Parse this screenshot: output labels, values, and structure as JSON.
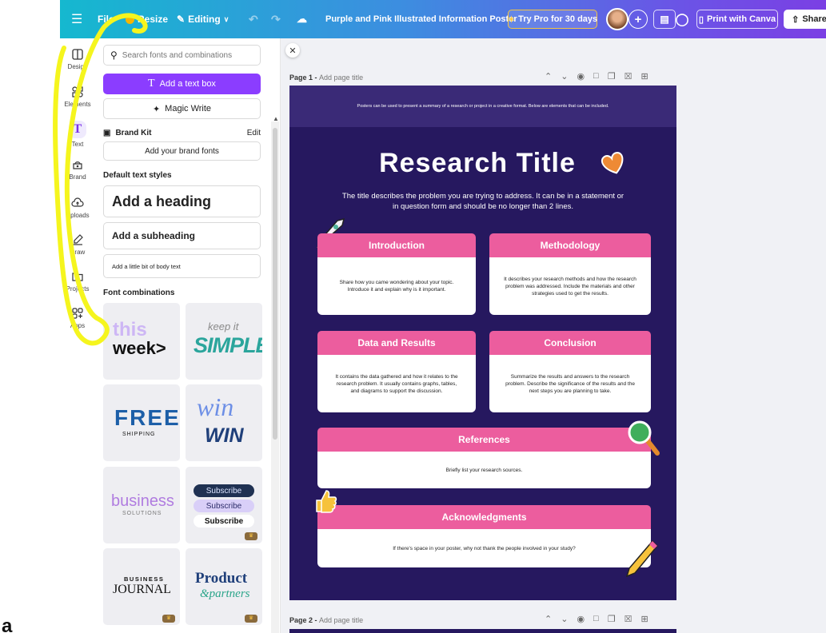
{
  "topbar": {
    "file": "File",
    "resize": "Resize",
    "editing": "Editing",
    "doc_title": "Purple and Pink Illustrated Information Poster",
    "try_pro": "Try Pro for 30 days",
    "print": "Print with Canva",
    "share": "Share"
  },
  "rail": {
    "design": "Design",
    "elements": "Elements",
    "text": "Text",
    "brand": "Brand",
    "uploads": "Uploads",
    "draw": "Draw",
    "projects": "Projects",
    "apps": "Apps"
  },
  "panel": {
    "search_placeholder": "Search fonts and combinations",
    "add_text_box": "Add a text box",
    "magic_write": "Magic Write",
    "brand_kit": "Brand Kit",
    "edit": "Edit",
    "add_brand_fonts": "Add your brand fonts",
    "default_styles": "Default text styles",
    "heading": "Add a heading",
    "subheading": "Add a subheading",
    "body": "Add a little bit of body text",
    "font_combos": "Font combinations",
    "tiles": {
      "this": "this",
      "week": "week>",
      "keepit": "keep it",
      "simple": "SIMPLE",
      "free": "FREE",
      "shipping": "SHIPPING",
      "win1": "win",
      "win2": "WIN",
      "business": "business",
      "solutions": "SOLUTIONS",
      "subscribe": "Subscribe",
      "bj1": "BUSINESS",
      "bj2": "JOURNAL",
      "prod1": "Product",
      "prod2": "&partners"
    }
  },
  "canvas": {
    "page1_label": "Page 1 -",
    "page1_title": "Add page title",
    "page2_label": "Page 2 -",
    "page2_title": "Add page title"
  },
  "poster": {
    "banner": "Posters can be used to present a summary of a research or project in a creative format. Below are elements that can be included.",
    "title": "Research Title",
    "subtitle": "The title describes the problem you are trying to address. It can be in a statement or in question form and should be no longer than 2 lines.",
    "intro_h": "Introduction",
    "intro_b": "Share how you came wondering about your topic. Introduce it and explain why is it important.",
    "method_h": "Methodology",
    "method_b": "It describes your research methods and how the research problem was addressed. Include the materials and other strategies used to get the results.",
    "data_h": "Data and Results",
    "data_b": "It contains the data gathered and how it relates to the research problem. It usually contains graphs, tables, and diagrams to support the discussion.",
    "concl_h": "Conclusion",
    "concl_b": "Summarize the results and answers to the research problem. Describe the significance of the results and the next steps you are planning to take.",
    "ref_h": "References",
    "ref_b": "Briefly list your research sources.",
    "ack_h": "Acknowledgments",
    "ack_b": "If there's space in your poster, why not thank the people involved in your study?"
  },
  "annotation_letter": "a",
  "colors": {
    "accent": "#8b3dff",
    "poster_bg": "#26185f",
    "card_pink": "#ec5d9e",
    "highlight": "#f5f51e"
  }
}
